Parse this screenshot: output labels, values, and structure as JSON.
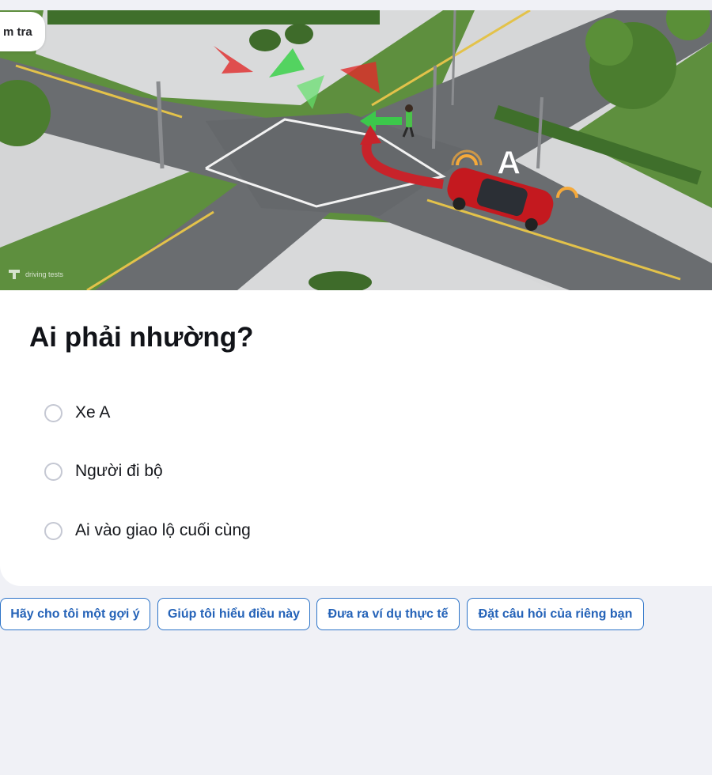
{
  "header": {
    "tab_partial_label": "m tra"
  },
  "image": {
    "watermark": "driving tests"
  },
  "question": {
    "title": "Ai phải nhường?"
  },
  "options": [
    {
      "label": "Xe A",
      "selected": false
    },
    {
      "label": "Người đi bộ",
      "selected": false
    },
    {
      "label": "Ai vào giao lộ cuối cùng",
      "selected": false
    }
  ],
  "scene_labels": {
    "car": "A"
  },
  "chips": [
    {
      "label": "Hãy cho tôi một gợi ý"
    },
    {
      "label": "Giúp tôi hiểu điều này"
    },
    {
      "label": "Đưa ra ví dụ thực tế"
    },
    {
      "label": "Đặt câu hỏi của riêng bạn"
    }
  ],
  "colors": {
    "accent": "#2d74c8",
    "background": "#f0f1f6",
    "card": "#ffffff"
  }
}
